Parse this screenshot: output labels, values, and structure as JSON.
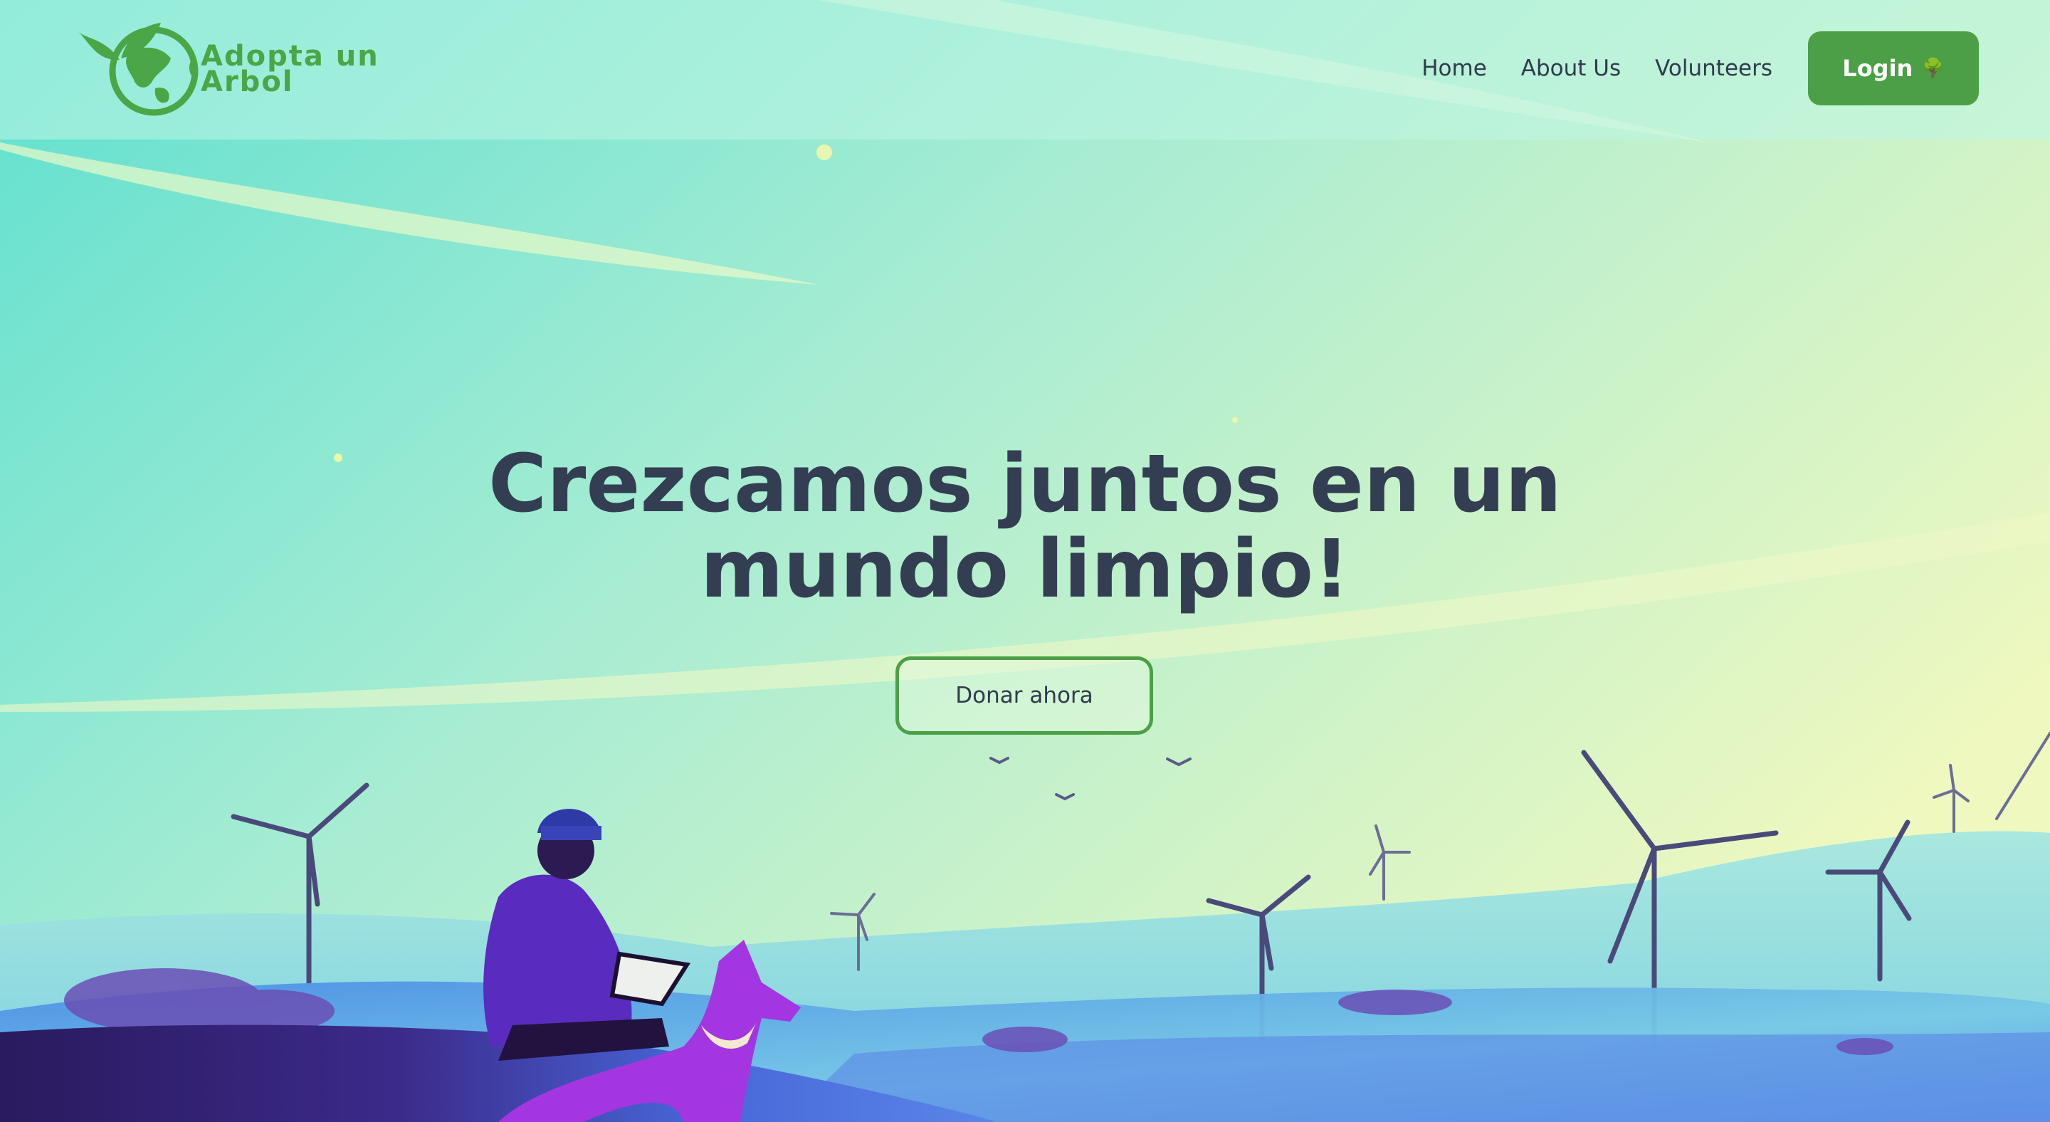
{
  "brand": {
    "name_line1": "Adopta un",
    "name_line2": "Arbol",
    "logo_icon": "globe-with-leaves-icon",
    "color": "#4aa646"
  },
  "nav": {
    "links": [
      "Home",
      "About Us",
      "Volunteers"
    ],
    "login_label": "Login",
    "login_icon": "tree-icon",
    "login_icon_glyph": "🌳",
    "accent": "#4c9f47"
  },
  "hero": {
    "title_line1": "Crezcamos juntos en un",
    "title_line2": "mundo limpio!",
    "cta_label": "Donar ahora",
    "title_color": "#343e52"
  },
  "background": {
    "illustration": "person-with-laptop-and-dog-on-hills-with-wind-turbines"
  }
}
